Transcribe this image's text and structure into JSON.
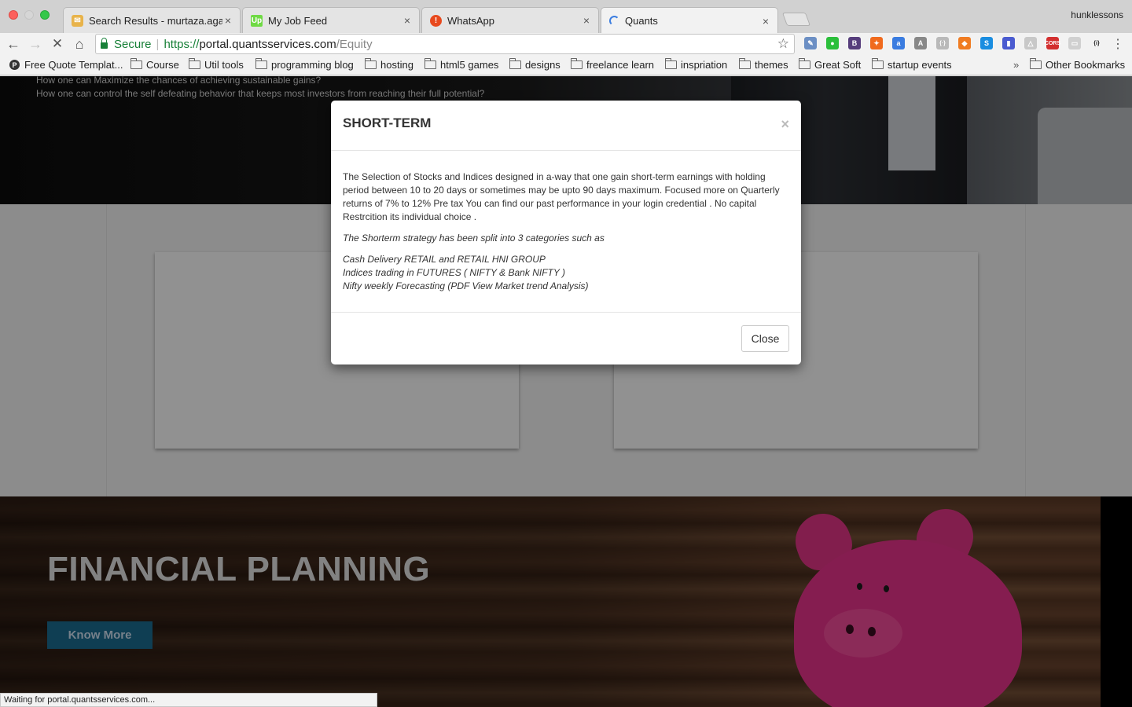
{
  "browser": {
    "profile_name": "hunklessons",
    "tabs": [
      {
        "title": "Search Results - murtaza.aga"
      },
      {
        "title": "My Job Feed",
        "favicon": "Up"
      },
      {
        "title": "WhatsApp",
        "favicon": "!"
      },
      {
        "title": "Quants"
      }
    ],
    "omnibox": {
      "secure_label": "Secure",
      "url_scheme": "https://",
      "url_host": "portal.quantsservices.com",
      "url_path": "/Equity"
    },
    "extensions": [
      {
        "icon": "extension-icon-1",
        "color": "#6c8fc4",
        "glyph": "✎"
      },
      {
        "icon": "extension-icon-2",
        "color": "#2bbf3b",
        "glyph": "●"
      },
      {
        "icon": "bootstrap-icon",
        "color": "#563d7c",
        "glyph": "B"
      },
      {
        "icon": "firebug-icon",
        "color": "#f06a1d",
        "glyph": "✦"
      },
      {
        "icon": "extension-icon-5",
        "color": "#3a7ce0",
        "glyph": "a"
      },
      {
        "icon": "angular-icon",
        "color": "#888888",
        "glyph": "A"
      },
      {
        "icon": "json-icon",
        "color": "#b9b9b9",
        "glyph": "{·}"
      },
      {
        "icon": "extension-icon-8",
        "color": "#f07c22",
        "glyph": "◆"
      },
      {
        "icon": "extension-icon-9",
        "color": "#1a8de0",
        "glyph": "S"
      },
      {
        "icon": "extension-icon-10",
        "color": "#4a5bd0",
        "glyph": "▮"
      },
      {
        "icon": "drive-icon",
        "color": "#c8c8c8",
        "glyph": "△"
      },
      {
        "icon": "cors-icon",
        "color": "#d32f2f",
        "glyph": "CORS"
      },
      {
        "icon": "extension-icon-13",
        "color": "#d0d0d0",
        "glyph": "▭"
      },
      {
        "icon": "json-viewer-icon",
        "color": "#f2f2f2",
        "glyph": "{i}"
      }
    ],
    "bookmarks": [
      {
        "label": "Free Quote Templat...",
        "icon": "pinterest-icon",
        "glyph": "P"
      },
      {
        "label": "Course",
        "icon": "folder-icon"
      },
      {
        "label": "Util tools",
        "icon": "folder-icon"
      },
      {
        "label": "programming blog",
        "icon": "folder-icon"
      },
      {
        "label": "hosting",
        "icon": "folder-icon"
      },
      {
        "label": "html5 games",
        "icon": "folder-icon"
      },
      {
        "label": "designs",
        "icon": "folder-icon"
      },
      {
        "label": "freelance learn",
        "icon": "folder-icon"
      },
      {
        "label": "inspriation",
        "icon": "folder-icon"
      },
      {
        "label": "themes",
        "icon": "folder-icon"
      },
      {
        "label": "Great Soft",
        "icon": "folder-icon"
      },
      {
        "label": "startup events",
        "icon": "folder-icon"
      }
    ],
    "bookmarks_overflow": "»",
    "other_bookmarks": "Other Bookmarks",
    "status_text": "Waiting for portal.quantsservices.com..."
  },
  "page": {
    "faq_lines": [
      "How one can Maximize the chances of achieving sustainable gains?",
      "How one can control the self defeating behavior that keeps most investors from reaching their full potential?"
    ],
    "financial_planning": {
      "title": "FINANCIAL PLANNING",
      "button_label": "Know More"
    }
  },
  "modal": {
    "title": "SHORT-TERM",
    "close_x": "×",
    "paragraph": "The Selection of Stocks and Indices designed in a-way that one gain short-term earnings with holding period between 10 to 20 days or sometimes may be upto 90 days maximum. Focused more on Quarterly returns of 7% to 12% Pre tax You can find our past performance in your login credential . No capital Restrcition its individual choice .",
    "strategy_intro": "The Shorterm strategy has been split into 3 categories such as",
    "categories": [
      "Cash Delivery RETAIL and RETAIL HNI GROUP",
      "Indices trading in FUTURES ( NIFTY &  Bank NIFTY )",
      "Nifty weekly Forecasting (PDF View Market trend Analysis)"
    ],
    "close_button_label": "Close"
  }
}
